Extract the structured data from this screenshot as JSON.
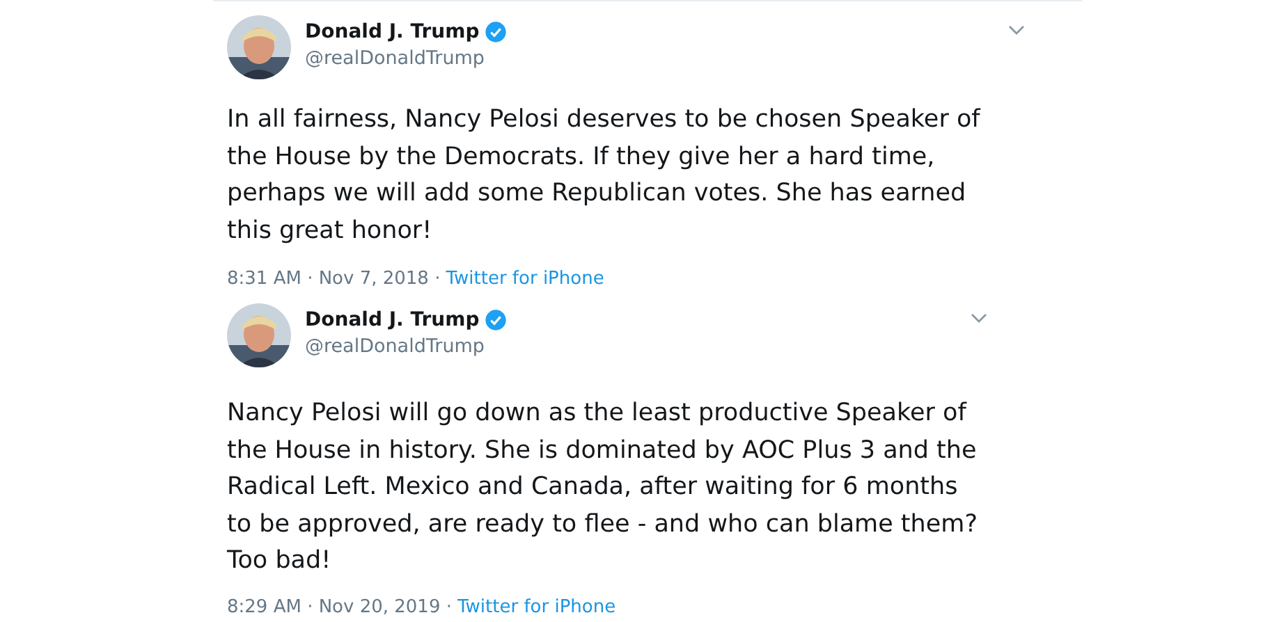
{
  "tweets": [
    {
      "author": "Donald J. Trump",
      "verified": true,
      "handle": "@realDonaldTrump",
      "text": "In all fairness, Nancy Pelosi deserves to be chosen Speaker of\nthe House by the Democrats. If they give her a hard time,\nperhaps we will add some Republican votes. She has earned\nthis great honor!",
      "timestamp": "8:31 AM · Nov 7, 2018 ·",
      "source": "Twitter for iPhone"
    },
    {
      "author": "Donald J. Trump",
      "verified": true,
      "handle": "@realDonaldTrump",
      "text": "Nancy Pelosi will go down as the least productive Speaker of\nthe House in history. She is dominated by AOC Plus 3 and the\nRadical Left. Mexico and Canada, after waiting for 6 months\nto be approved, are ready to flee - and who can blame them?\nToo bad!",
      "timestamp": "8:29 AM · Nov 20, 2019 ·",
      "source": "Twitter for iPhone"
    }
  ]
}
